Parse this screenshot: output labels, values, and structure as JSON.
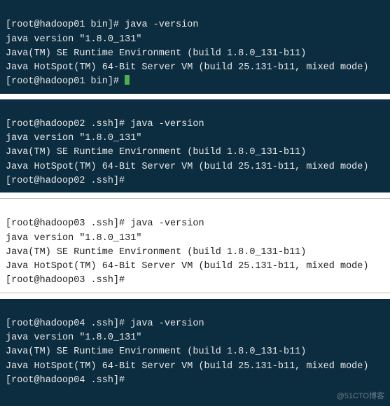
{
  "terminals": [
    {
      "style": "dark",
      "lines": [
        {
          "type": "cmd",
          "prompt": "[root@hadoop01 bin]# ",
          "command": "java -version"
        },
        {
          "type": "out",
          "text": "java version \"1.8.0_131\""
        },
        {
          "type": "out",
          "text": "Java(TM) SE Runtime Environment (build 1.8.0_131-b11)"
        },
        {
          "type": "out",
          "text": "Java HotSpot(TM) 64-Bit Server VM (build 25.131-b11, mixed mode)"
        },
        {
          "type": "cmd",
          "prompt": "[root@hadoop01 bin]# ",
          "command": "",
          "cursor": true
        }
      ]
    },
    {
      "style": "dark",
      "lines": [
        {
          "type": "cmd",
          "prompt": "[root@hadoop02 .ssh]# ",
          "command": "java -version"
        },
        {
          "type": "out",
          "text": "java version \"1.8.0_131\""
        },
        {
          "type": "out",
          "text": "Java(TM) SE Runtime Environment (build 1.8.0_131-b11)"
        },
        {
          "type": "out",
          "text": "Java HotSpot(TM) 64-Bit Server VM (build 25.131-b11, mixed mode)"
        },
        {
          "type": "cmd",
          "prompt": "[root@hadoop02 .ssh]# ",
          "command": ""
        }
      ]
    },
    {
      "style": "light",
      "lines": [
        {
          "type": "cmd",
          "prompt": "[root@hadoop03 .ssh]# ",
          "command": "java -version"
        },
        {
          "type": "out",
          "text": "java version \"1.8.0_131\""
        },
        {
          "type": "out",
          "text": "Java(TM) SE Runtime Environment (build 1.8.0_131-b11)"
        },
        {
          "type": "out",
          "text": "Java HotSpot(TM) 64-Bit Server VM (build 25.131-b11, mixed mode)"
        },
        {
          "type": "cmd",
          "prompt": "[root@hadoop03 .ssh]# ",
          "command": ""
        }
      ]
    },
    {
      "style": "dark",
      "lines": [
        {
          "type": "cmd",
          "prompt": "[root@hadoop04 .ssh]# ",
          "command": "java -version"
        },
        {
          "type": "out",
          "text": "java version \"1.8.0_131\""
        },
        {
          "type": "out",
          "text": "Java(TM) SE Runtime Environment (build 1.8.0_131-b11)"
        },
        {
          "type": "out",
          "text": "Java HotSpot(TM) 64-Bit Server VM (build 25.131-b11, mixed mode)"
        },
        {
          "type": "cmd",
          "prompt": "[root@hadoop04 .ssh]# ",
          "command": ""
        }
      ],
      "watermark": "@51CTO博客"
    }
  ]
}
